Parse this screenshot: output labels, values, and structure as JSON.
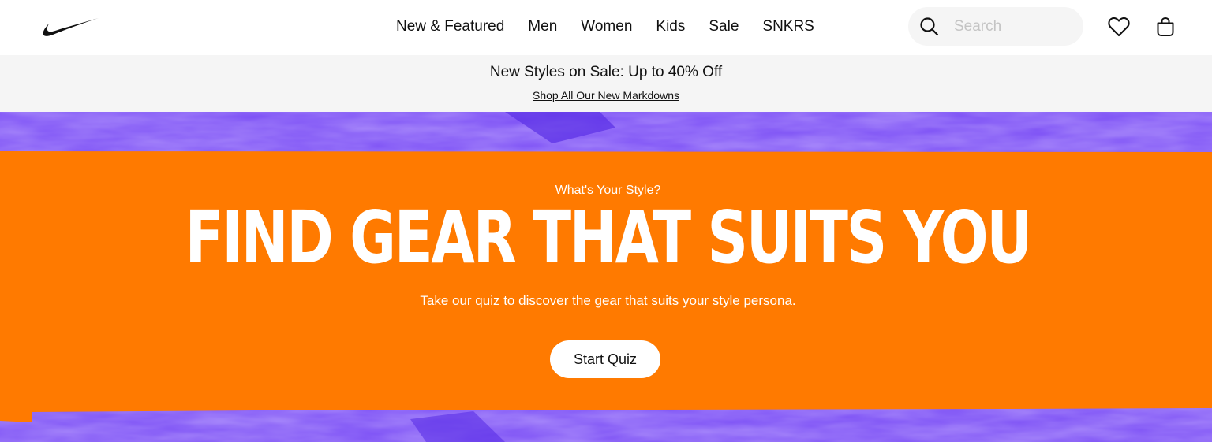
{
  "header": {
    "logo_name": "Nike",
    "nav": [
      {
        "label": "New & Featured"
      },
      {
        "label": "Men"
      },
      {
        "label": "Women"
      },
      {
        "label": "Kids"
      },
      {
        "label": "Sale"
      },
      {
        "label": "SNKRS"
      }
    ],
    "search": {
      "placeholder": "Search",
      "value": "",
      "icon": "search-icon"
    },
    "favorites_icon": "heart-icon",
    "bag_icon": "bag-icon"
  },
  "promo": {
    "headline": "New Styles on Sale: Up to 40% Off",
    "link": "Shop All Our New Markdowns"
  },
  "hero": {
    "eyebrow": "What's Your Style?",
    "headline": "FIND GEAR THAT SUITS YOU",
    "subtitle": "Take our quiz to discover the gear that suits your style persona.",
    "cta_label": "Start Quiz",
    "colors": {
      "banner": "#ff7a00",
      "background": "#7a4df5",
      "text": "#ffffff"
    }
  }
}
